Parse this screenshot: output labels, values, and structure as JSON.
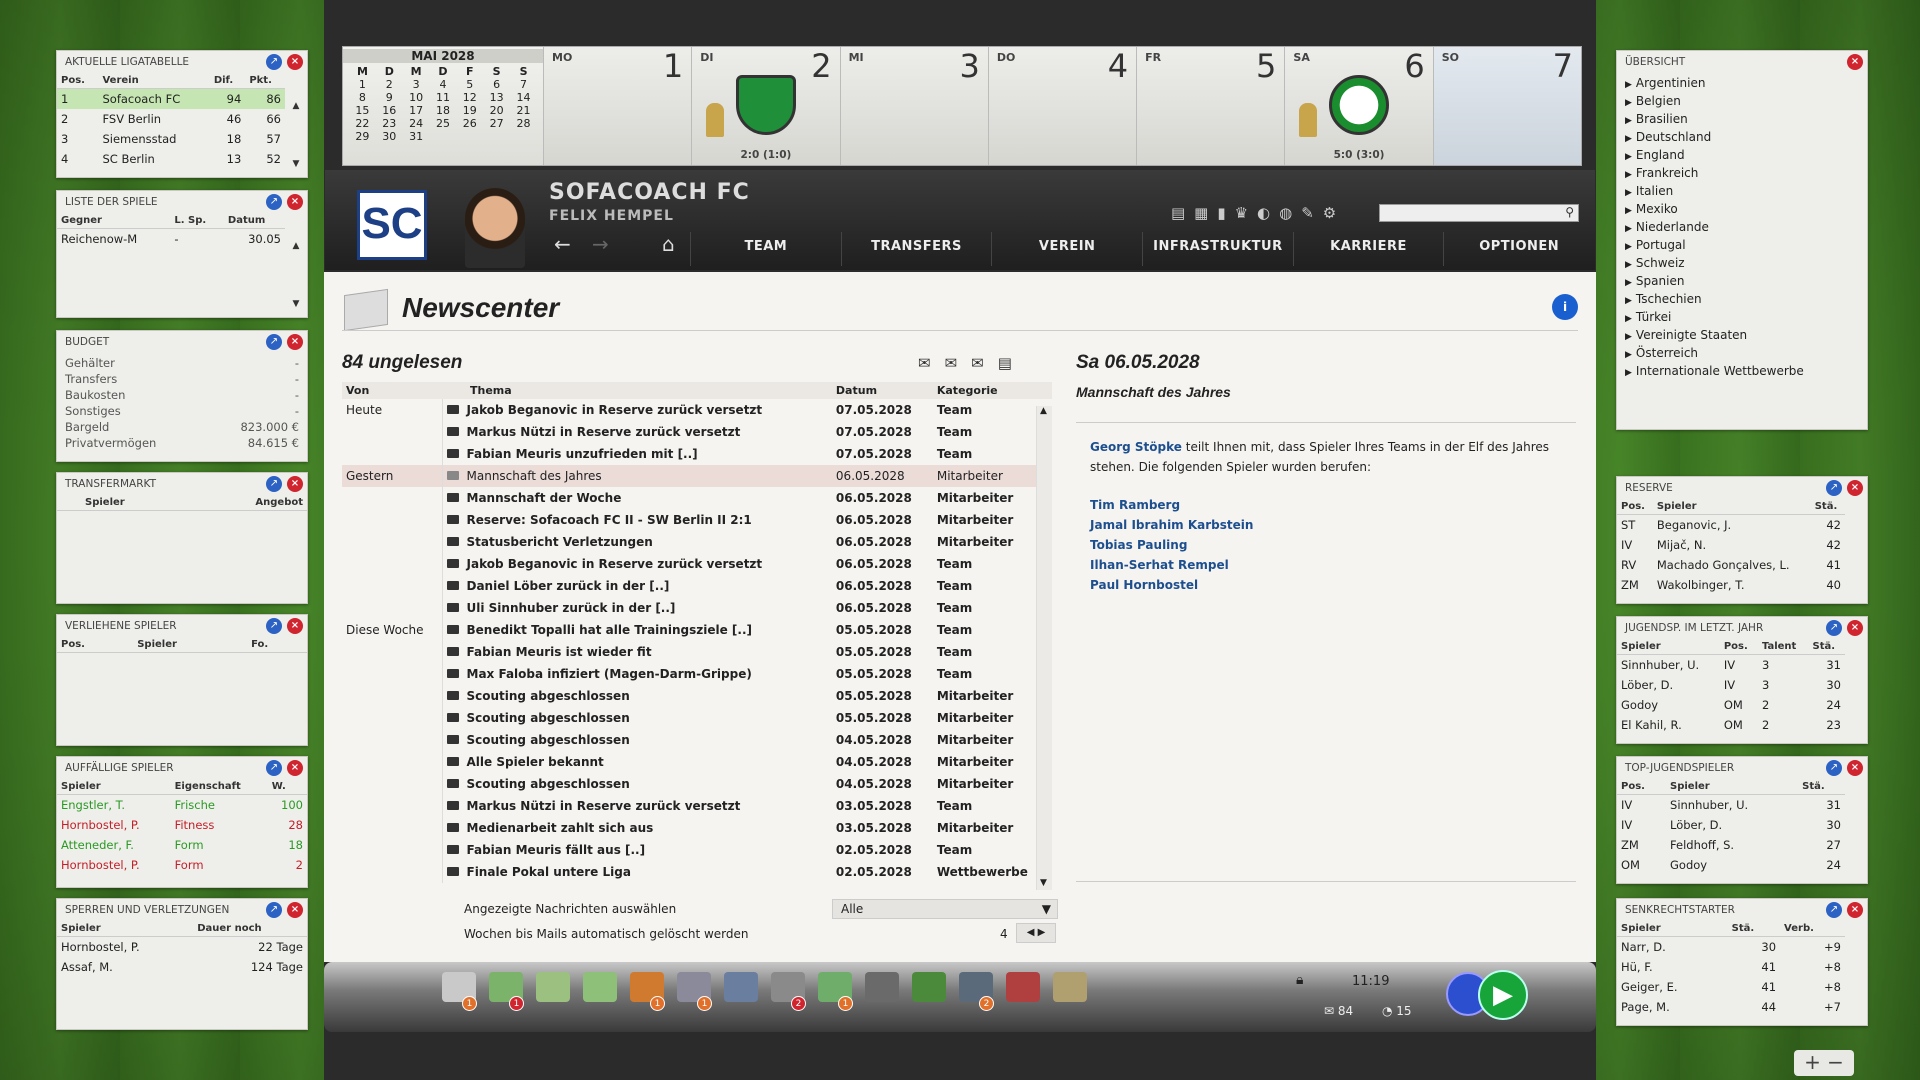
{
  "left": {
    "league": {
      "title": "Aktuelle Ligatabelle",
      "cols": [
        "Pos.",
        "Verein",
        "Dif.",
        "Pkt."
      ],
      "rows": [
        [
          "1",
          "Sofacoach FC",
          "94",
          "86"
        ],
        [
          "2",
          "FSV Berlin",
          "46",
          "66"
        ],
        [
          "3",
          "Siemensstad",
          "18",
          "57"
        ],
        [
          "4",
          "SC Berlin",
          "13",
          "52"
        ]
      ]
    },
    "games": {
      "title": "Liste der Spiele",
      "cols": [
        "Gegner",
        "L. Sp.",
        "Datum"
      ],
      "rows": [
        [
          "Reichenow-M",
          "-",
          "30.05"
        ]
      ]
    },
    "budget": {
      "title": "Budget",
      "rows": [
        [
          "Gehälter",
          "-"
        ],
        [
          "Transfers",
          "-"
        ],
        [
          "Baukosten",
          "-"
        ],
        [
          "Sonstiges",
          "-"
        ],
        [
          "Bargeld",
          "823.000 €"
        ],
        [
          "Privatvermögen",
          "84.615 €"
        ]
      ]
    },
    "transfer": {
      "title": "Transfermarkt",
      "cols": [
        "Spieler",
        "Angebot"
      ]
    },
    "loaned": {
      "title": "Verliehene Spieler",
      "cols": [
        "Pos.",
        "Spieler",
        "Fo."
      ]
    },
    "notable": {
      "title": "Auffällige Spieler",
      "cols": [
        "Spieler",
        "Eigenschaft",
        "W."
      ],
      "rows": [
        [
          "Engstler, T.",
          "Frische",
          "100",
          "green"
        ],
        [
          "Hornbostel, P.",
          "Fitness",
          "28",
          "red"
        ],
        [
          "Atteneder, F.",
          "Form",
          "18",
          "green"
        ],
        [
          "Hornbostel, P.",
          "Form",
          "2",
          "red"
        ]
      ]
    },
    "injuries": {
      "title": "Sperren und Verletzungen",
      "cols": [
        "Spieler",
        "Dauer noch"
      ],
      "rows": [
        [
          "Hornbostel, P.",
          "22 Tage"
        ],
        [
          "Assaf, M.",
          "124 Tage"
        ]
      ]
    }
  },
  "calendar": {
    "month": "MAI 2028",
    "weekdays": [
      "M",
      "D",
      "M",
      "D",
      "F",
      "S",
      "S"
    ],
    "weeks": [
      [
        "1",
        "2",
        "3",
        "4",
        "5",
        "6",
        "7"
      ],
      [
        "8",
        "9",
        "10",
        "11",
        "12",
        "13",
        "14"
      ],
      [
        "15",
        "16",
        "17",
        "18",
        "19",
        "20",
        "21"
      ],
      [
        "22",
        "23",
        "24",
        "25",
        "26",
        "27",
        "28"
      ],
      [
        "29",
        "30",
        "31",
        "",
        "",
        "",
        ""
      ]
    ],
    "days": [
      {
        "dn": "MO",
        "num": "1",
        "res": ""
      },
      {
        "dn": "DI",
        "num": "2",
        "res": "2:0 (1:0)"
      },
      {
        "dn": "MI",
        "num": "3",
        "res": ""
      },
      {
        "dn": "DO",
        "num": "4",
        "res": ""
      },
      {
        "dn": "FR",
        "num": "5",
        "res": ""
      },
      {
        "dn": "SA",
        "num": "6",
        "res": "5:0 (3:0)"
      },
      {
        "dn": "SO",
        "num": "7",
        "res": ""
      }
    ]
  },
  "club": {
    "logo": "SC",
    "name": "SOFACOACH FC",
    "manager": "FELIX HEMPEL"
  },
  "nav": [
    "TEAM",
    "TRANSFERS",
    "VEREIN",
    "INFRASTRUKTUR",
    "KARRIERE",
    "OPTIONEN"
  ],
  "news": {
    "title": "Newscenter",
    "unread": "84 ungelesen",
    "cols": [
      "Von",
      "Thema",
      "Datum",
      "Kategorie"
    ],
    "rows": [
      [
        "Heute",
        "Jakob Beganovic in Reserve zurück versetzt",
        "07.05.2028",
        "Team",
        "b"
      ],
      [
        "",
        "Markus Nützi in Reserve zurück versetzt",
        "07.05.2028",
        "Team",
        "b"
      ],
      [
        "",
        "Fabian Meuris unzufrieden mit [..]",
        "07.05.2028",
        "Team",
        "b"
      ],
      [
        "Gestern",
        "Mannschaft des Jahres",
        "06.05.2028",
        "Mitarbeiter",
        "sel"
      ],
      [
        "",
        "Mannschaft der Woche",
        "06.05.2028",
        "Mitarbeiter",
        "b"
      ],
      [
        "",
        "Reserve: Sofacoach FC II - SW Berlin II 2:1",
        "06.05.2028",
        "Mitarbeiter",
        "b"
      ],
      [
        "",
        "Statusbericht Verletzungen",
        "06.05.2028",
        "Mitarbeiter",
        "b"
      ],
      [
        "",
        "Jakob Beganovic in Reserve zurück versetzt",
        "06.05.2028",
        "Team",
        "b"
      ],
      [
        "",
        "Daniel Löber zurück in der [..]",
        "06.05.2028",
        "Team",
        "b"
      ],
      [
        "",
        "Uli Sinnhuber zurück in der [..]",
        "06.05.2028",
        "Team",
        "b"
      ],
      [
        "Diese Woche",
        "Benedikt Topalli hat alle Trainingsziele [..]",
        "05.05.2028",
        "Team",
        "b"
      ],
      [
        "",
        "Fabian Meuris ist wieder fit",
        "05.05.2028",
        "Team",
        "b"
      ],
      [
        "",
        "Max Faloba infiziert (Magen-Darm-Grippe)",
        "05.05.2028",
        "Team",
        "b"
      ],
      [
        "",
        "Scouting abgeschlossen",
        "05.05.2028",
        "Mitarbeiter",
        "b"
      ],
      [
        "",
        "Scouting abgeschlossen",
        "05.05.2028",
        "Mitarbeiter",
        "b"
      ],
      [
        "",
        "Scouting abgeschlossen",
        "04.05.2028",
        "Mitarbeiter",
        "b"
      ],
      [
        "",
        "Alle Spieler bekannt",
        "04.05.2028",
        "Mitarbeiter",
        "b"
      ],
      [
        "",
        "Scouting abgeschlossen",
        "04.05.2028",
        "Mitarbeiter",
        "b"
      ],
      [
        "",
        "Markus Nützi in Reserve zurück versetzt",
        "03.05.2028",
        "Team",
        "b"
      ],
      [
        "",
        "Medienarbeit zahlt sich aus",
        "03.05.2028",
        "Mitarbeiter",
        "b"
      ],
      [
        "",
        "Fabian Meuris fällt aus [..]",
        "02.05.2028",
        "Team",
        "b"
      ],
      [
        "",
        "Finale Pokal untere Liga",
        "02.05.2028",
        "Wettbewerbe",
        "b"
      ]
    ],
    "filter_label": "Angezeigte Nachrichten auswählen",
    "filter_value": "Alle",
    "weeks_label": "Wochen bis Mails automatisch gelöscht werden",
    "weeks_value": "4",
    "detail": {
      "date": "Sa 06.05.2028",
      "subject": "Mannschaft des Jahres",
      "sender": "Georg Stöpke",
      "body": " teilt Ihnen mit, dass Spieler Ihres Teams in der Elf des Jahres stehen. Die folgenden Spieler wurden berufen:",
      "players": [
        "Tim Ramberg",
        "Jamal Ibrahim Karbstein",
        "Tobias Pauling",
        "Ilhan-Serhat Rempel",
        "Paul Hornbostel"
      ]
    }
  },
  "toolbar": {
    "time": "11:19",
    "mails": "84",
    "msgs": "15",
    "badges": [
      "1",
      "1",
      "",
      "",
      "1",
      "1",
      "",
      "2",
      "1",
      "",
      "",
      "2",
      "",
      ""
    ]
  },
  "right": {
    "overview": {
      "title": "Übersicht",
      "items": [
        "Argentinien",
        "Belgien",
        "Brasilien",
        "Deutschland",
        "England",
        "Frankreich",
        "Italien",
        "Mexiko",
        "Niederlande",
        "Portugal",
        "Schweiz",
        "Spanien",
        "Tschechien",
        "Türkei",
        "Vereinigte Staaten",
        "Österreich",
        "Internationale Wettbewerbe"
      ]
    },
    "reserve": {
      "title": "Reserve",
      "cols": [
        "Pos.",
        "Spieler",
        "Stä."
      ],
      "rows": [
        [
          "ST",
          "Beganovic, J.",
          "42"
        ],
        [
          "IV",
          "Mijač, N.",
          "42"
        ],
        [
          "RV",
          "Machado Gonçalves, L.",
          "41"
        ],
        [
          "ZM",
          "Wakolbinger, T.",
          "40"
        ]
      ]
    },
    "youth": {
      "title": "Jugendsp. im letzt. Jahr",
      "cols": [
        "Spieler",
        "Pos.",
        "Talent",
        "Stä."
      ],
      "rows": [
        [
          "Sinnhuber, U.",
          "IV",
          "3",
          "31"
        ],
        [
          "Löber, D.",
          "IV",
          "3",
          "30"
        ],
        [
          "Godoy",
          "OM",
          "2",
          "24"
        ],
        [
          "El Kahil, R.",
          "OM",
          "2",
          "23"
        ]
      ]
    },
    "topyouth": {
      "title": "Top-Jugendspieler",
      "cols": [
        "Pos.",
        "Spieler",
        "Stä."
      ],
      "rows": [
        [
          "IV",
          "Sinnhuber, U.",
          "31"
        ],
        [
          "IV",
          "Löber, D.",
          "30"
        ],
        [
          "ZM",
          "Feldhoff, S.",
          "27"
        ],
        [
          "OM",
          "Godoy",
          "24"
        ]
      ]
    },
    "risers": {
      "title": "Senkrechtstarter",
      "cols": [
        "Spieler",
        "Stä.",
        "Verb."
      ],
      "rows": [
        [
          "Narr, D.",
          "30",
          "+9"
        ],
        [
          "Hü, F.",
          "41",
          "+8"
        ],
        [
          "Geiger, E.",
          "41",
          "+8"
        ],
        [
          "Page, M.",
          "44",
          "+7"
        ]
      ]
    }
  },
  "colors": {
    "accent": "#2c62c4",
    "close": "#d0242f",
    "link": "#1d4f8f",
    "highlight": "#c5e6b2",
    "play": "#17a53a"
  }
}
